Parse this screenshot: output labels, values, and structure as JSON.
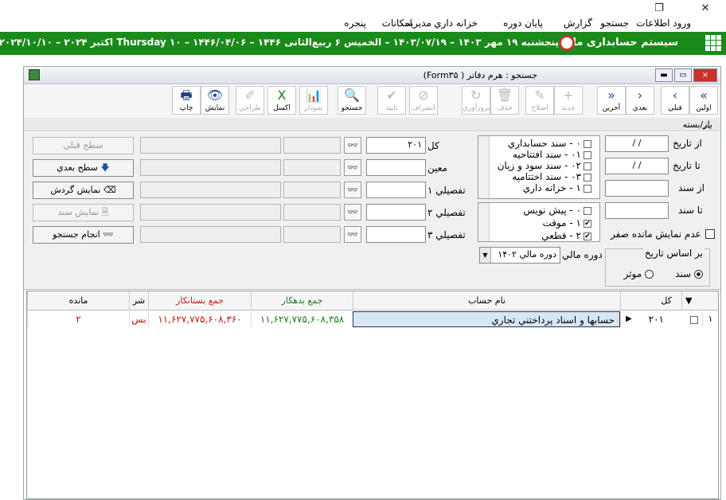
{
  "topbar": {
    "restore_icon": "restore-icon",
    "close_icon": "close-icon"
  },
  "menu": [
    {
      "label": "ورود اطلاعات"
    },
    {
      "label": "جستجو"
    },
    {
      "label": "گزارش"
    },
    {
      "label": "پایان دوره"
    },
    {
      "label": "خزانه داري"
    },
    {
      "label": "مديريت"
    },
    {
      "label": "امكانات"
    },
    {
      "label": "پنجره"
    }
  ],
  "app": {
    "title": "سیستم حسابداری مالی",
    "date_line": "پنجشنبه ۱۹ مهر ۱۴۰۳ – ۱۴۰۳/۰۷/۱۹ – الخميس ۶ ربيع‌الثانی ۱۴۴۶ – ۱۴۴۶/۰۴/۰۶ – ۱۰ Thursday اکتبر ۲۰۲۴ – ۲۰۲۴/۱۰/۱۰"
  },
  "window": {
    "title": "جستجو : هرم دفاتر ( Form۳۵)",
    "close": "×",
    "max": "▭",
    "min": "▬"
  },
  "toolbar": [
    {
      "label": "اولين",
      "icon": "«",
      "enabled": true
    },
    {
      "label": "قبلي",
      "icon": "‹",
      "enabled": true
    },
    {
      "label": "بعدي",
      "icon": "›",
      "enabled": true
    },
    {
      "label": "آخرين",
      "icon": "»",
      "enabled": true
    },
    {
      "label": "جديد",
      "icon": "+",
      "enabled": false
    },
    {
      "label": "اصلاح",
      "icon": "✎",
      "enabled": false
    },
    {
      "label": "حذف",
      "icon": "🗑",
      "enabled": false
    },
    {
      "label": "بروزآوري",
      "icon": "↻",
      "enabled": false
    },
    {
      "label": "انصراف",
      "icon": "⊘",
      "enabled": false
    },
    {
      "label": "تاييد",
      "icon": "✔",
      "enabled": false
    },
    {
      "label": "جستجو",
      "icon": "🔍",
      "enabled": true
    },
    {
      "label": "نمودار",
      "icon": "📊",
      "enabled": false
    },
    {
      "label": "اکسل",
      "icon": "X",
      "enabled": true
    },
    {
      "label": "طراحي",
      "icon": "✐",
      "enabled": false
    },
    {
      "label": "نمايش",
      "icon": "👁",
      "enabled": true
    },
    {
      "label": "چاپ",
      "icon": "🖶",
      "enabled": true
    }
  ],
  "section": {
    "label": "باز/بسته",
    "chevron_icon": "chevron-up-icon"
  },
  "filters": {
    "from_date_label": "از تاريخ",
    "to_date_label": "تا تاريخ",
    "from_doc_label": "از سند",
    "to_doc_label": "تا سند",
    "from_date": "/  /",
    "to_date": "/  /",
    "zero_balance_label": "عدم نمايش مانده صفر",
    "date_basis_label": "بر اساس تاريخ",
    "basis_doc": "سند",
    "basis_effective": "موثر",
    "period_label": "دوره مالي",
    "period_value": "دوره مالي ۱۴۰۲"
  },
  "doc_types": [
    "۰ - سند حسابداري",
    "۰۱ - سند افتتاحيه",
    "۰۲ - سند سود و زيان",
    "۰۳ - سند اختتاميه",
    "۱ - خزانه داري"
  ],
  "doc_status": [
    {
      "label": "۰ - پيش نويس",
      "checked": false
    },
    {
      "label": "۱ - موقت",
      "checked": true
    },
    {
      "label": "۲ - قطعي",
      "checked": true
    }
  ],
  "levels": {
    "kol_label": "کل",
    "kol_value": "۲۰۱",
    "moein_label": "معين",
    "tafsili1_label": "تفصيلي ۱",
    "tafsili2_label": "تفصيلي ۲",
    "tafsili3_label": "تفصيلي ۳"
  },
  "buttons": {
    "prev_level": "سطح قبلي",
    "next_level": "سطح بعدي",
    "show_turnover": "نمايش گردش",
    "show_doc": "نمايش سند",
    "do_search": "انجام جستجو"
  },
  "grid": {
    "headers": {
      "kol": "کل",
      "account_name": "نام حساب",
      "debit": "جمع بدهکار",
      "credit": "جمع بستانکار",
      "desc": "شر",
      "balance": "مانده"
    },
    "rows": [
      {
        "index": "۱",
        "kol": "۲۰۱",
        "account_name": "حسابها و اسناد پرداختني تجاري",
        "debit": "۱۱,۶۲۷,۷۷۵,۶۰۸,۳۵۸",
        "credit": "۱۱,۶۲۷,۷۷۵,۶۰۸,۳۶۰",
        "desc": "بس",
        "balance": "۲"
      }
    ]
  },
  "colors": {
    "green": "#1a8a1a",
    "debit": "#1a7a1a",
    "credit": "#c01818"
  }
}
